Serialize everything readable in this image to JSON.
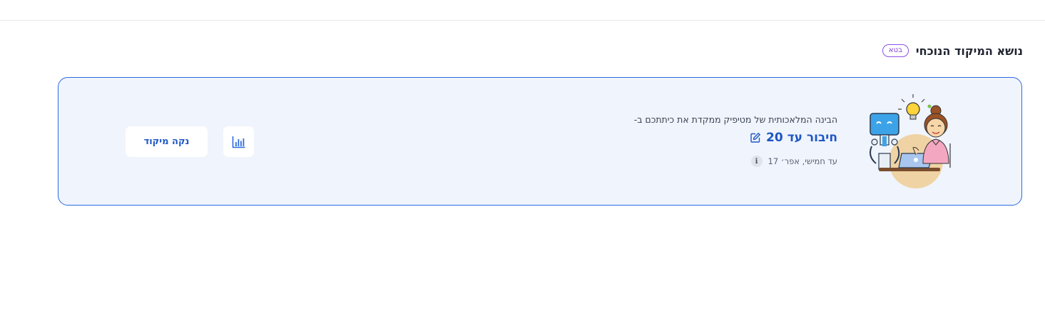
{
  "header": {
    "title": "נושא המיקוד הנוכחי",
    "badge": "בטא"
  },
  "focus": {
    "intro": "הבינה המלאכותית של מטיפיק ממקדת את כיתתכם ב-",
    "topic": "חיבור עד 20",
    "date": "עד חמישי, אפר׳ 17",
    "info_icon_glyph": "i"
  },
  "actions": {
    "clear_label": "נקה מיקוד",
    "stats_icon": "bar-chart-icon",
    "edit_icon": "pencil-edit-icon"
  },
  "colors": {
    "accent": "#1e56c4",
    "card_border": "#2c6be0",
    "card_bg": "#eff4fd",
    "badge": "#8d52e6"
  }
}
